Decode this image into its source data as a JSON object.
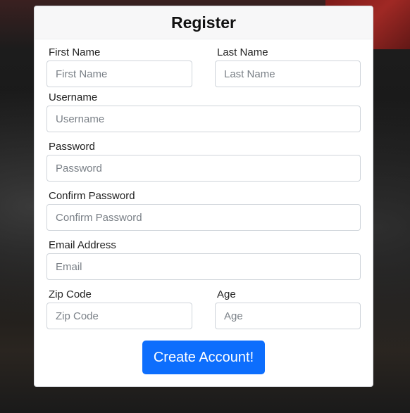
{
  "form": {
    "title": "Register",
    "fields": {
      "first_name": {
        "label": "First Name",
        "placeholder": "First Name",
        "value": ""
      },
      "last_name": {
        "label": "Last Name",
        "placeholder": "Last Name",
        "value": ""
      },
      "username": {
        "label": "Username",
        "placeholder": "Username",
        "value": ""
      },
      "password": {
        "label": "Password",
        "placeholder": "Password",
        "value": ""
      },
      "confirm_password": {
        "label": "Confirm Password",
        "placeholder": "Confirm Password",
        "value": ""
      },
      "email": {
        "label": "Email Address",
        "placeholder": "Email",
        "value": ""
      },
      "zip_code": {
        "label": "Zip Code",
        "placeholder": "Zip Code",
        "value": ""
      },
      "age": {
        "label": "Age",
        "placeholder": "Age",
        "value": ""
      }
    },
    "submit_label": "Create Account!"
  },
  "colors": {
    "primary_button": "#0d6efd",
    "card_header_bg": "#f7f7f8",
    "input_border": "#cfd4da"
  }
}
